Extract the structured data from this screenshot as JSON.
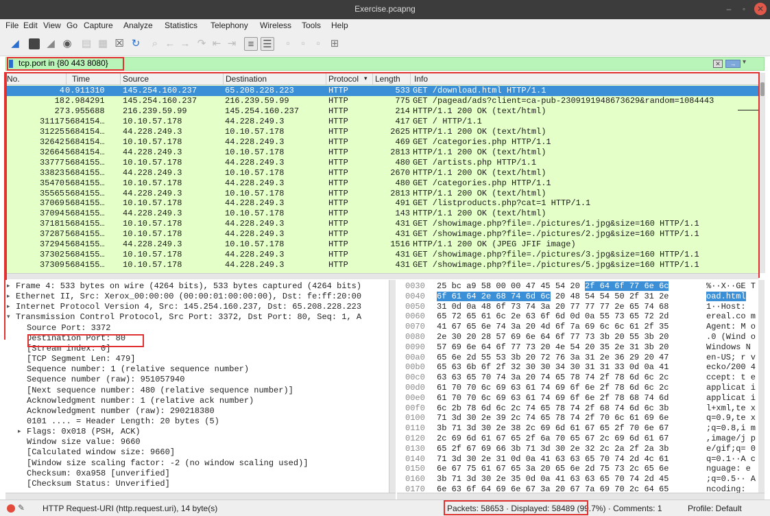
{
  "window": {
    "title": "Exercise.pcapng",
    "min_glyph": "–",
    "max_glyph": "◦",
    "close_glyph": "✕"
  },
  "menu": [
    "File",
    "Edit",
    "View",
    "Go",
    "Capture",
    "Analyze",
    "Statistics",
    "Telephony",
    "Wireless",
    "Tools",
    "Help"
  ],
  "toolbar_icons": [
    "shark-fin-start-icon",
    "stop-square-icon",
    "restart-fin-icon",
    "capture-options-icon",
    "open-file-icon",
    "save-file-icon",
    "close-file-icon",
    "reload-icon",
    "find-packet-icon",
    "go-back-icon",
    "go-forward-icon",
    "go-to-packet-icon",
    "first-packet-icon",
    "last-packet-icon",
    "autoscroll-icon",
    "colorize-icon",
    "zoom-in-icon",
    "zoom-out-icon",
    "normal-size-icon",
    "resize-columns-icon"
  ],
  "filter": {
    "value": "tcp.port in {80 443 8080}"
  },
  "packet_list": {
    "columns": {
      "no": "No.",
      "time": "Time",
      "source": "Source",
      "destination": "Destination",
      "protocol": "Protocol",
      "length": "Length",
      "info": "Info"
    },
    "sort_indicator": "▾",
    "rows": [
      {
        "no": "4",
        "time": "0.911310",
        "source": "145.254.160.237",
        "destination": "65.208.228.223",
        "protocol": "HTTP",
        "length": "533",
        "info": "GET /download.html HTTP/1.1",
        "selected": true
      },
      {
        "no": "18",
        "time": "2.984291",
        "source": "145.254.160.237",
        "destination": "216.239.59.99",
        "protocol": "HTTP",
        "length": "775",
        "info": "GET /pagead/ads?client=ca-pub-2309191948673629&random=1084443"
      },
      {
        "no": "27",
        "time": "3.955688",
        "source": "216.239.59.99",
        "destination": "145.254.160.237",
        "protocol": "HTTP",
        "length": "214",
        "info": "HTTP/1.1 200 OK  (text/html)"
      },
      {
        "no": "31117",
        "time": "5684154…",
        "source": "10.10.57.178",
        "destination": "44.228.249.3",
        "protocol": "HTTP",
        "length": "417",
        "info": "GET / HTTP/1.1"
      },
      {
        "no": "31225",
        "time": "5684154…",
        "source": "44.228.249.3",
        "destination": "10.10.57.178",
        "protocol": "HTTP",
        "length": "2625",
        "info": "HTTP/1.1 200 OK  (text/html)"
      },
      {
        "no": "32642",
        "time": "5684154…",
        "source": "10.10.57.178",
        "destination": "44.228.249.3",
        "protocol": "HTTP",
        "length": "469",
        "info": "GET /categories.php HTTP/1.1"
      },
      {
        "no": "32664",
        "time": "5684154…",
        "source": "44.228.249.3",
        "destination": "10.10.57.178",
        "protocol": "HTTP",
        "length": "2813",
        "info": "HTTP/1.1 200 OK  (text/html)"
      },
      {
        "no": "33777",
        "time": "5684155…",
        "source": "10.10.57.178",
        "destination": "44.228.249.3",
        "protocol": "HTTP",
        "length": "480",
        "info": "GET /artists.php HTTP/1.1"
      },
      {
        "no": "33823",
        "time": "5684155…",
        "source": "44.228.249.3",
        "destination": "10.10.57.178",
        "protocol": "HTTP",
        "length": "2670",
        "info": "HTTP/1.1 200 OK  (text/html)"
      },
      {
        "no": "35470",
        "time": "5684155…",
        "source": "10.10.57.178",
        "destination": "44.228.249.3",
        "protocol": "HTTP",
        "length": "480",
        "info": "GET /categories.php HTTP/1.1"
      },
      {
        "no": "35565",
        "time": "5684155…",
        "source": "44.228.249.3",
        "destination": "10.10.57.178",
        "protocol": "HTTP",
        "length": "2813",
        "info": "HTTP/1.1 200 OK  (text/html)"
      },
      {
        "no": "37069",
        "time": "5684155…",
        "source": "10.10.57.178",
        "destination": "44.228.249.3",
        "protocol": "HTTP",
        "length": "491",
        "info": "GET /listproducts.php?cat=1 HTTP/1.1"
      },
      {
        "no": "37094",
        "time": "5684155…",
        "source": "44.228.249.3",
        "destination": "10.10.57.178",
        "protocol": "HTTP",
        "length": "143",
        "info": "HTTP/1.1 200 OK  (text/html)"
      },
      {
        "no": "37181",
        "time": "5684155…",
        "source": "10.10.57.178",
        "destination": "44.228.249.3",
        "protocol": "HTTP",
        "length": "431",
        "info": "GET /showimage.php?file=./pictures/1.jpg&size=160 HTTP/1.1"
      },
      {
        "no": "37287",
        "time": "5684155…",
        "source": "10.10.57.178",
        "destination": "44.228.249.3",
        "protocol": "HTTP",
        "length": "431",
        "info": "GET /showimage.php?file=./pictures/2.jpg&size=160 HTTP/1.1"
      },
      {
        "no": "37294",
        "time": "5684155…",
        "source": "44.228.249.3",
        "destination": "10.10.57.178",
        "protocol": "HTTP",
        "length": "1516",
        "info": "HTTP/1.1 200 OK  (JPEG JFIF image)"
      },
      {
        "no": "37302",
        "time": "5684155…",
        "source": "10.10.57.178",
        "destination": "44.228.249.3",
        "protocol": "HTTP",
        "length": "431",
        "info": "GET /showimage.php?file=./pictures/3.jpg&size=160 HTTP/1.1"
      },
      {
        "no": "37309",
        "time": "5684155…",
        "source": "10.10.57.178",
        "destination": "44.228.249.3",
        "protocol": "HTTP",
        "length": "431",
        "info": "GET /showimage.php?file=./pictures/5.jpg&size=160 HTTP/1.1"
      }
    ]
  },
  "details": {
    "lines": [
      {
        "text": "Frame 4: 533 bytes on wire (4264 bits), 533 bytes captured (4264 bits)",
        "indent": 0,
        "twisty": "▸"
      },
      {
        "text": "Ethernet II, Src: Xerox_00:00:00 (00:00:01:00:00:00), Dst: fe:ff:20:00",
        "indent": 0,
        "twisty": "▸"
      },
      {
        "text": "Internet Protocol Version 4, Src: 145.254.160.237, Dst: 65.208.228.223",
        "indent": 0,
        "twisty": "▸"
      },
      {
        "text": "Transmission Control Protocol, Src Port: 3372, Dst Port: 80, Seq: 1, A",
        "indent": 0,
        "twisty": "▾"
      },
      {
        "text": "Source Port: 3372",
        "indent": 1
      },
      {
        "text": "Destination Port: 80",
        "indent": 1
      },
      {
        "text": "[Stream index: 0]",
        "indent": 1
      },
      {
        "text": "[TCP Segment Len: 479]",
        "indent": 1
      },
      {
        "text": "Sequence number: 1    (relative sequence number)",
        "indent": 1
      },
      {
        "text": "Sequence number (raw): 951057940",
        "indent": 1
      },
      {
        "text": "[Next sequence number: 480    (relative sequence number)]",
        "indent": 1
      },
      {
        "text": "Acknowledgment number: 1    (relative ack number)",
        "indent": 1
      },
      {
        "text": "Acknowledgment number (raw): 290218380",
        "indent": 1
      },
      {
        "text": "0101 .... = Header Length: 20 bytes (5)",
        "indent": 1
      },
      {
        "text": "Flags: 0x018 (PSH, ACK)",
        "indent": 1,
        "twisty": "▸"
      },
      {
        "text": "Window size value: 9660",
        "indent": 1
      },
      {
        "text": "[Calculated window size: 9660]",
        "indent": 1
      },
      {
        "text": "[Window size scaling factor: -2 (no window scaling used)]",
        "indent": 1
      },
      {
        "text": "Checksum: 0xa958 [unverified]",
        "indent": 1
      },
      {
        "text": "[Checksum Status: Unverified]",
        "indent": 1
      }
    ]
  },
  "bytes": {
    "lines": [
      {
        "off": "0030",
        "hex_plain": "25 bc a9 58 00 00 47 45  54 20 ",
        "hex_hl": "2f 64 6f 77 6e 6c",
        "hex_after": "",
        "asc_plain": "%··X··GE T",
        "asc_hl": "",
        "asc_after": ""
      },
      {
        "off": "0040",
        "hex_plain": "",
        "hex_hl": "6f 61 64 2e 68 74 6d 6c",
        "hex_after": "  20 48 54 54 50 2f 31 2e",
        "asc_plain": "",
        "asc_hl": "oad.html",
        "asc_after": ""
      },
      {
        "off": "0050",
        "hex_plain": "31 0d 0a 48 6f 73 74 3a  20 77 77 77 2e 65 74 68",
        "hex_hl": "",
        "hex_after": "",
        "asc_plain": "1··Host:",
        "asc_hl": "",
        "asc_after": ""
      },
      {
        "off": "0060",
        "hex_plain": "65 72 65 61 6c 2e 63 6f  6d 0d 0a 55 73 65 72 2d",
        "hex_hl": "",
        "hex_after": "",
        "asc_plain": "ereal.co m",
        "asc_hl": "",
        "asc_after": ""
      },
      {
        "off": "0070",
        "hex_plain": "41 67 65 6e 74 3a 20 4d  6f 7a 69 6c 6c 61 2f 35",
        "hex_hl": "",
        "hex_after": "",
        "asc_plain": "Agent: M o",
        "asc_hl": "",
        "asc_after": ""
      },
      {
        "off": "0080",
        "hex_plain": "2e 30 20 28 57 69 6e 64  6f 77 73 3b 20 55 3b 20",
        "hex_hl": "",
        "hex_after": "",
        "asc_plain": ".0 (Wind o",
        "asc_hl": "",
        "asc_after": ""
      },
      {
        "off": "0090",
        "hex_plain": "57 69 6e 64 6f 77 73 20  4e 54 20 35 2e 31 3b 20",
        "hex_hl": "",
        "hex_after": "",
        "asc_plain": "Windows  N",
        "asc_hl": "",
        "asc_after": ""
      },
      {
        "off": "00a0",
        "hex_plain": "65 6e 2d 55 53 3b 20 72  76 3a 31 2e 36 29 20 47",
        "hex_hl": "",
        "hex_after": "",
        "asc_plain": "en-US; r v",
        "asc_hl": "",
        "asc_after": ""
      },
      {
        "off": "00b0",
        "hex_plain": "65 63 6b 6f 2f 32 30 30  34 30 31 31 33 0d 0a 41",
        "hex_hl": "",
        "hex_after": "",
        "asc_plain": "ecko/200 4",
        "asc_hl": "",
        "asc_after": ""
      },
      {
        "off": "00c0",
        "hex_plain": "63 63 65 70 74 3a 20 74  65 78 74 2f 78 6d 6c 2c",
        "hex_hl": "",
        "hex_after": "",
        "asc_plain": "ccept: t e",
        "asc_hl": "",
        "asc_after": ""
      },
      {
        "off": "00d0",
        "hex_plain": "61 70 70 6c 69 63 61 74  69 6f 6e 2f 78 6d 6c 2c",
        "hex_hl": "",
        "hex_after": "",
        "asc_plain": "applicat i",
        "asc_hl": "",
        "asc_after": ""
      },
      {
        "off": "00e0",
        "hex_plain": "61 70 70 6c 69 63 61 74  69 6f 6e 2f 78 68 74 6d",
        "hex_hl": "",
        "hex_after": "",
        "asc_plain": "applicat i",
        "asc_hl": "",
        "asc_after": ""
      },
      {
        "off": "00f0",
        "hex_plain": "6c 2b 78 6d 6c 2c 74 65  78 74 2f 68 74 6d 6c 3b",
        "hex_hl": "",
        "hex_after": "",
        "asc_plain": "l+xml,te x",
        "asc_hl": "",
        "asc_after": ""
      },
      {
        "off": "0100",
        "hex_plain": "71 3d 30 2e 39 2c 74 65  78 74 2f 70 6c 61 69 6e",
        "hex_hl": "",
        "hex_after": "",
        "asc_plain": "q=0.9,te x",
        "asc_hl": "",
        "asc_after": ""
      },
      {
        "off": "0110",
        "hex_plain": "3b 71 3d 30 2e 38 2c 69  6d 61 67 65 2f 70 6e 67",
        "hex_hl": "",
        "hex_after": "",
        "asc_plain": ";q=0.8,i m",
        "asc_hl": "",
        "asc_after": ""
      },
      {
        "off": "0120",
        "hex_plain": "2c 69 6d 61 67 65 2f 6a  70 65 67 2c 69 6d 61 67",
        "hex_hl": "",
        "hex_after": "",
        "asc_plain": ",image/j p",
        "asc_hl": "",
        "asc_after": ""
      },
      {
        "off": "0130",
        "hex_plain": "65 2f 67 69 66 3b 71 3d  30 2e 32 2c 2a 2f 2a 3b",
        "hex_hl": "",
        "hex_after": "",
        "asc_plain": "e/gif;q= 0",
        "asc_hl": "",
        "asc_after": ""
      },
      {
        "off": "0140",
        "hex_plain": "71 3d 30 2e 31 0d 0a 41  63 63 65 70 74 2d 4c 61",
        "hex_hl": "",
        "hex_after": "",
        "asc_plain": "q=0.1··A c",
        "asc_hl": "",
        "asc_after": ""
      },
      {
        "off": "0150",
        "hex_plain": "6e 67 75 61 67 65 3a 20  65 6e 2d 75 73 2c 65 6e",
        "hex_hl": "",
        "hex_after": "",
        "asc_plain": "nguage:  e",
        "asc_hl": "",
        "asc_after": ""
      },
      {
        "off": "0160",
        "hex_plain": "3b 71 3d 30 2e 35 0d 0a  41 63 63 65 70 74 2d 45",
        "hex_hl": "",
        "hex_after": "",
        "asc_plain": ";q=0.5·· A",
        "asc_hl": "",
        "asc_after": ""
      },
      {
        "off": "0170",
        "hex_plain": "6e 63 6f 64 69 6e 67 3a  20 67 7a 69 70 2c 64 65",
        "hex_hl": "",
        "hex_after": "",
        "asc_plain": "ncoding:",
        "asc_hl": "",
        "asc_after": ""
      }
    ]
  },
  "status": {
    "field": "HTTP Request-URI (http.request.uri), 14 byte(s)",
    "packets": "Packets: 58653 · Displayed: 58489 (99.7%) · Comments: 1",
    "profile": "Profile: Default"
  },
  "colors": {
    "highlight": "#e03030",
    "selected": "#3a8fd7",
    "filter_ok": "#b9f5b9",
    "http_row": "#e4ffc7"
  }
}
